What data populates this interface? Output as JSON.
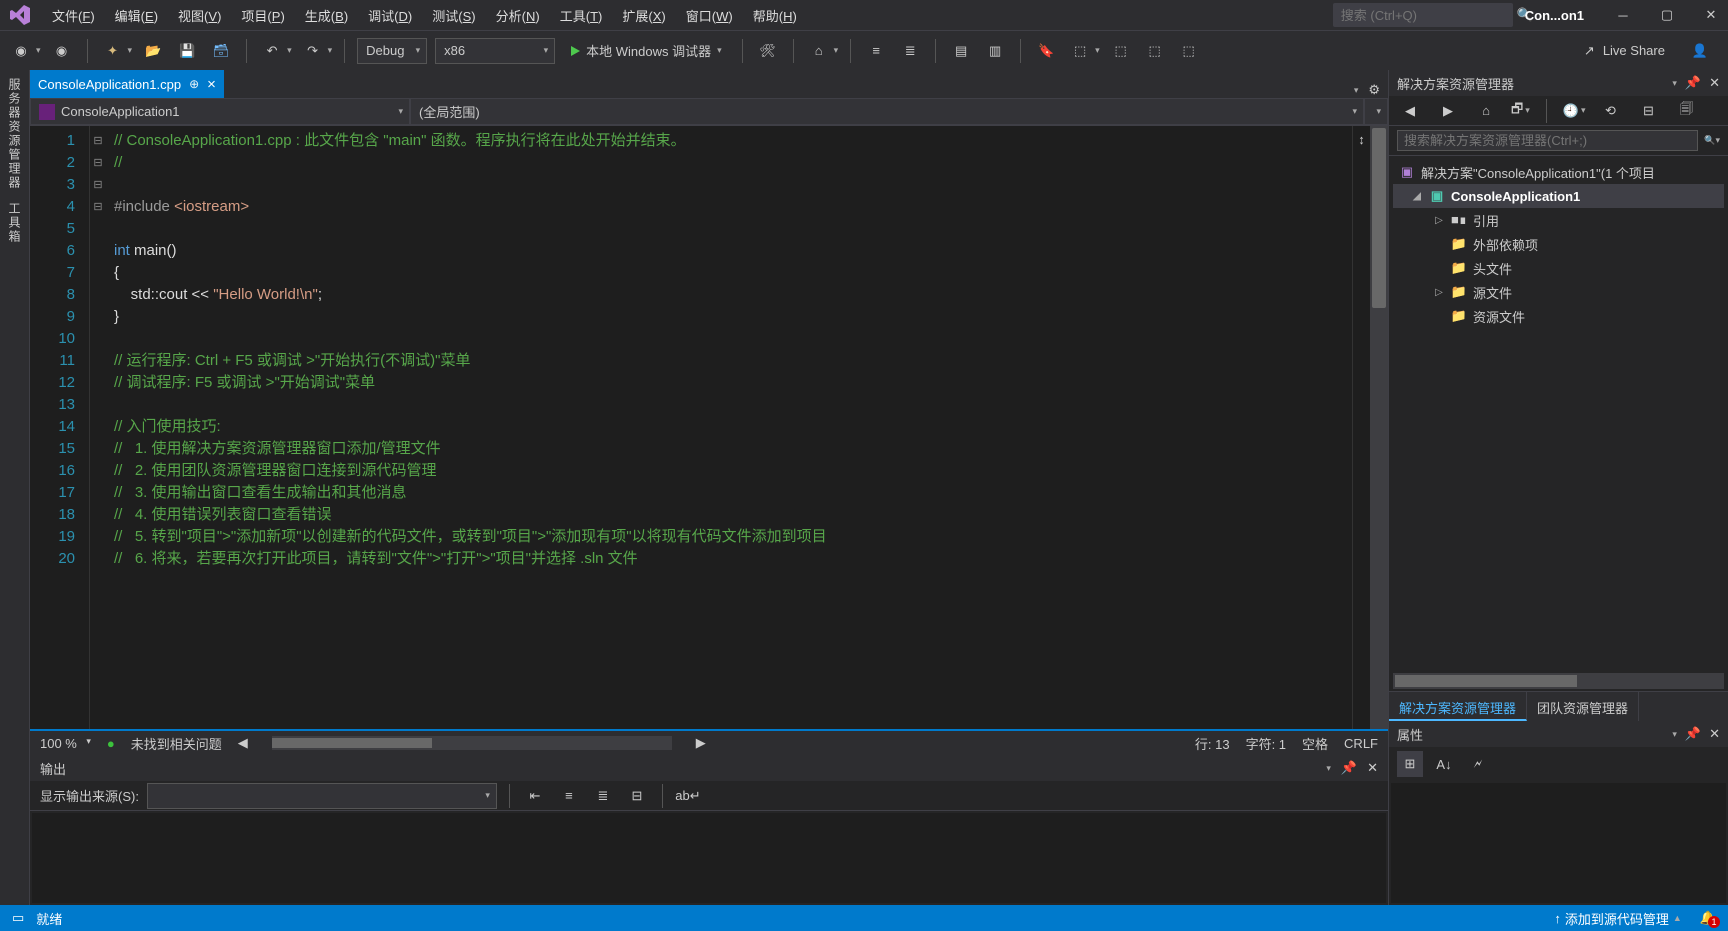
{
  "title": {
    "appShort": "Con...on1"
  },
  "menu": [
    {
      "label": "文件",
      "key": "F"
    },
    {
      "label": "编辑",
      "key": "E"
    },
    {
      "label": "视图",
      "key": "V"
    },
    {
      "label": "项目",
      "key": "P"
    },
    {
      "label": "生成",
      "key": "B"
    },
    {
      "label": "调试",
      "key": "D"
    },
    {
      "label": "测试",
      "key": "S"
    },
    {
      "label": "分析",
      "key": "N"
    },
    {
      "label": "工具",
      "key": "T"
    },
    {
      "label": "扩展",
      "key": "X"
    },
    {
      "label": "窗口",
      "key": "W"
    },
    {
      "label": "帮助",
      "key": "H"
    }
  ],
  "search": {
    "placeholder": "搜索 (Ctrl+Q)"
  },
  "toolbar": {
    "config": "Debug",
    "platform": "x86",
    "run": "本地 Windows 调试器",
    "liveshare": "Live Share"
  },
  "leftRail": [
    "服务器资源管理器",
    "工具箱"
  ],
  "tabs": {
    "active": "ConsoleApplication1.cpp"
  },
  "navCombo": {
    "project": "ConsoleApplication1",
    "scope": "(全局范围)"
  },
  "code": {
    "lines": [
      {
        "n": 1,
        "fold": "⊟",
        "html": "<span class='tok-comment'>// ConsoleApplication1.cpp : 此文件包含 \"main\" 函数。程序执行将在此处开始并结束。</span>"
      },
      {
        "n": 2,
        "fold": " ",
        "html": "<span class='tok-comment'>//</span>"
      },
      {
        "n": 3,
        "fold": " ",
        "html": ""
      },
      {
        "n": 4,
        "fold": " ",
        "html": "<span class='tok-include'>#include</span> <span class='tok-string'>&lt;iostream&gt;</span>"
      },
      {
        "n": 5,
        "fold": " ",
        "html": ""
      },
      {
        "n": 6,
        "fold": "⊟",
        "html": "<span class='tok-keyword'>int</span> main()"
      },
      {
        "n": 7,
        "fold": " ",
        "html": "{"
      },
      {
        "n": 8,
        "fold": " ",
        "html": "    std::cout &lt;&lt; <span class='tok-string'>\"Hello World!\\n\"</span>;"
      },
      {
        "n": 9,
        "fold": " ",
        "html": "}"
      },
      {
        "n": 10,
        "fold": " ",
        "html": ""
      },
      {
        "n": 11,
        "fold": "⊟",
        "html": "<span class='tok-comment'>// 运行程序: Ctrl + F5 或调试 &gt;\"开始执行(不调试)\"菜单</span>"
      },
      {
        "n": 12,
        "fold": " ",
        "html": "<span class='tok-comment'>// 调试程序: F5 或调试 &gt;\"开始调试\"菜单</span>"
      },
      {
        "n": 13,
        "fold": " ",
        "html": ""
      },
      {
        "n": 14,
        "fold": "⊟",
        "html": "<span class='tok-comment'>// 入门使用技巧: </span>"
      },
      {
        "n": 15,
        "fold": " ",
        "html": "<span class='tok-comment'>//   1. 使用解决方案资源管理器窗口添加/管理文件</span>"
      },
      {
        "n": 16,
        "fold": " ",
        "html": "<span class='tok-comment'>//   2. 使用团队资源管理器窗口连接到源代码管理</span>"
      },
      {
        "n": 17,
        "fold": " ",
        "html": "<span class='tok-comment'>//   3. 使用输出窗口查看生成输出和其他消息</span>"
      },
      {
        "n": 18,
        "fold": " ",
        "html": "<span class='tok-comment'>//   4. 使用错误列表窗口查看错误</span>"
      },
      {
        "n": 19,
        "fold": " ",
        "html": "<span class='tok-comment'>//   5. 转到\"项目\"&gt;\"添加新项\"以创建新的代码文件，或转到\"项目\"&gt;\"添加现有项\"以将现有代码文件添加到项目</span>"
      },
      {
        "n": 20,
        "fold": " ",
        "html": "<span class='tok-comment'>//   6. 将来，若要再次打开此项目，请转到\"文件\"&gt;\"打开\"&gt;\"项目\"并选择 .sln 文件</span>"
      }
    ]
  },
  "editorStatus": {
    "zoom": "100 %",
    "issues": "未找到相关问题",
    "line": "行: 13",
    "col": "字符: 1",
    "ins": "空格",
    "lineEnding": "CRLF"
  },
  "output": {
    "title": "输出",
    "sourceLabel": "显示输出来源(S):"
  },
  "solutionExplorer": {
    "title": "解决方案资源管理器",
    "searchPlaceholder": "搜索解决方案资源管理器(Ctrl+;)",
    "solution": "解决方案\"ConsoleApplication1\"(1 个项目",
    "project": "ConsoleApplication1",
    "nodes": [
      {
        "label": "引用",
        "exp": "▷",
        "icon": "ref"
      },
      {
        "label": "外部依赖项",
        "exp": " ",
        "icon": "folder"
      },
      {
        "label": "头文件",
        "exp": " ",
        "icon": "folder"
      },
      {
        "label": "源文件",
        "exp": "▷",
        "icon": "folder"
      },
      {
        "label": "资源文件",
        "exp": " ",
        "icon": "folder"
      }
    ],
    "tabs": {
      "active": "解决方案资源管理器",
      "other": "团队资源管理器"
    }
  },
  "properties": {
    "title": "属性"
  },
  "statusBar": {
    "ready": "就绪",
    "sourceControl": "添加到源代码管理",
    "notifications": "1"
  }
}
